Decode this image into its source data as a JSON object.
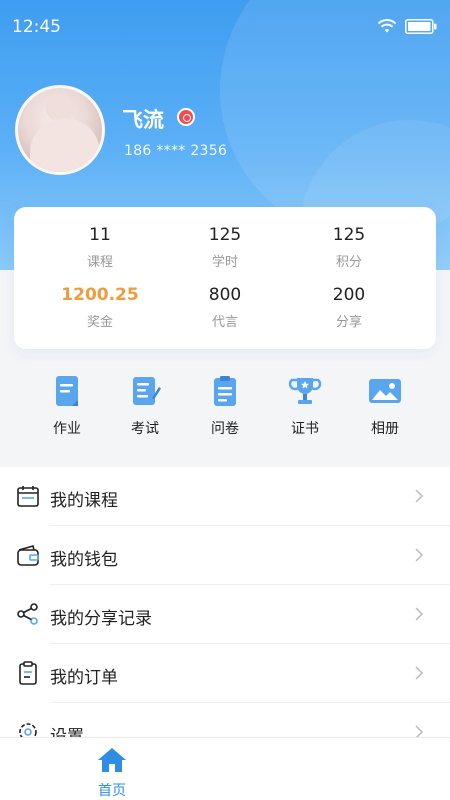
{
  "status_bar": {
    "time": "12:45"
  },
  "profile": {
    "name": "飞流",
    "phone": "186 **** 2356"
  },
  "stats": [
    {
      "value": "11",
      "label": "课程"
    },
    {
      "value": "125",
      "label": "学时"
    },
    {
      "value": "125",
      "label": "积分"
    },
    {
      "value": "1200.25",
      "label": "奖金"
    },
    {
      "value": "800",
      "label": "代言"
    },
    {
      "value": "200",
      "label": "分享"
    }
  ],
  "quick_actions": [
    {
      "label": "作业",
      "icon": "homework-icon"
    },
    {
      "label": "考试",
      "icon": "exam-icon"
    },
    {
      "label": "问卷",
      "icon": "survey-icon"
    },
    {
      "label": "证书",
      "icon": "certificate-icon"
    },
    {
      "label": "相册",
      "icon": "album-icon"
    }
  ],
  "menu": [
    {
      "label": "我的课程",
      "icon": "calendar-icon"
    },
    {
      "label": "我的钱包",
      "icon": "wallet-icon"
    },
    {
      "label": "我的分享记录",
      "icon": "share-icon"
    },
    {
      "label": "我的订单",
      "icon": "order-icon"
    },
    {
      "label": "设置",
      "icon": "settings-icon"
    }
  ],
  "tabbar": {
    "home_label": "首页"
  },
  "colors": {
    "primary": "#3e9df0",
    "accent_orange": "#f09b3c",
    "icon_blue": "#5aa6ee"
  }
}
